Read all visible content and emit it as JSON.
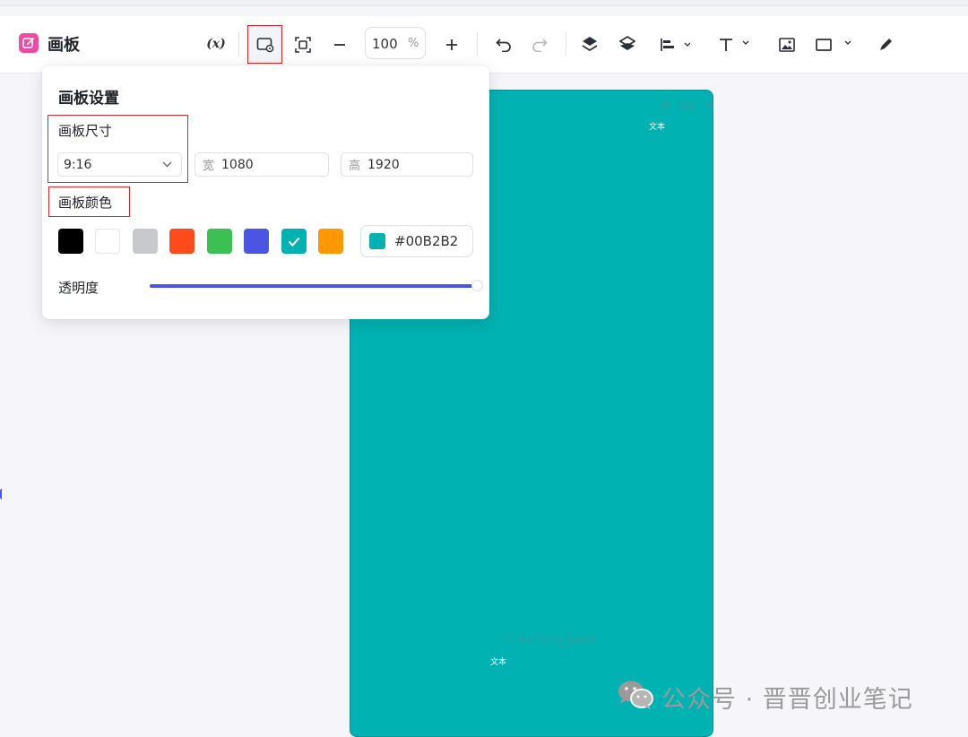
{
  "app": {
    "title": "画板"
  },
  "toolbar": {
    "variable_label": "(x)",
    "zoom_value": "100",
    "zoom_unit": "%"
  },
  "canvas": {
    "background": "#00B2B2",
    "top_label": "top_la",
    "top_text": "文本",
    "bottom_label": "bottom_label",
    "bottom_text": "文本"
  },
  "panel": {
    "title": "画板设置",
    "size": {
      "label": "画板尺寸",
      "ratio_value": "9:16",
      "width_prefix": "宽",
      "width_value": "1080",
      "height_prefix": "高",
      "height_value": "1920"
    },
    "color": {
      "label": "画板颜色",
      "swatches": [
        "#000000",
        "#ffffff",
        "#c8c9cd",
        "#ff4a1c",
        "#3cc053",
        "#4b55e3",
        "#00B2B2",
        "#ff9800"
      ],
      "selected": "#00B2B2",
      "hex_value": "#00B2B2"
    },
    "opacity": {
      "label": "透明度",
      "value": 100
    }
  },
  "watermark": {
    "text": "公众号 · 晋晋创业笔记"
  }
}
